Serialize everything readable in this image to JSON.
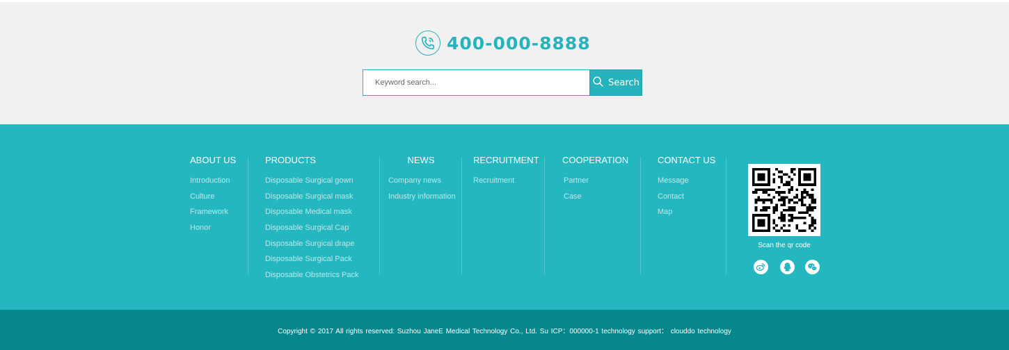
{
  "contact": {
    "phone": "400-000-8888"
  },
  "search": {
    "placeholder": "Keyword search...",
    "button_label": "Search"
  },
  "footer_nav": {
    "about": {
      "title": "ABOUT US",
      "items": [
        "Introduction",
        "Culture",
        "Framework",
        "Honor"
      ]
    },
    "products": {
      "title": "PRODUCTS",
      "items": [
        "Disposable Surgical gown",
        "Disposable Surgical mask",
        "Disposable Medical mask",
        "Disposable Surgical Cap",
        "Disposable Surgical drape",
        "Disposable Surgical Pack",
        "Disposable Obstetrics Pack"
      ]
    },
    "news": {
      "title": "NEWS",
      "items": [
        "Company news",
        "Industry information"
      ]
    },
    "recruitment": {
      "title": "RECRUITMENT",
      "items": [
        "Recruitment"
      ]
    },
    "cooperation": {
      "title": "COOPERATION",
      "items": [
        "Partner",
        "Case"
      ]
    },
    "contact_us": {
      "title": "CONTACT US",
      "items": [
        "Message",
        "Contact",
        "Map"
      ]
    }
  },
  "qr": {
    "caption": "Scan the qr code"
  },
  "social": {
    "icons": [
      "weibo-icon",
      "qq-icon",
      "wechat-icon"
    ]
  },
  "copyright": {
    "text": "Copyright © 2017 All rights reserved: Suzhou JaneE Medical Technology Co., Ltd.    Su ICP：000000-1    technology support： clouddo technology"
  },
  "colors": {
    "accent": "#27b3bd",
    "footer_bg": "#25b7bf",
    "bottom_bar_bg": "#07868c",
    "top_bg": "#f1f1f1"
  }
}
